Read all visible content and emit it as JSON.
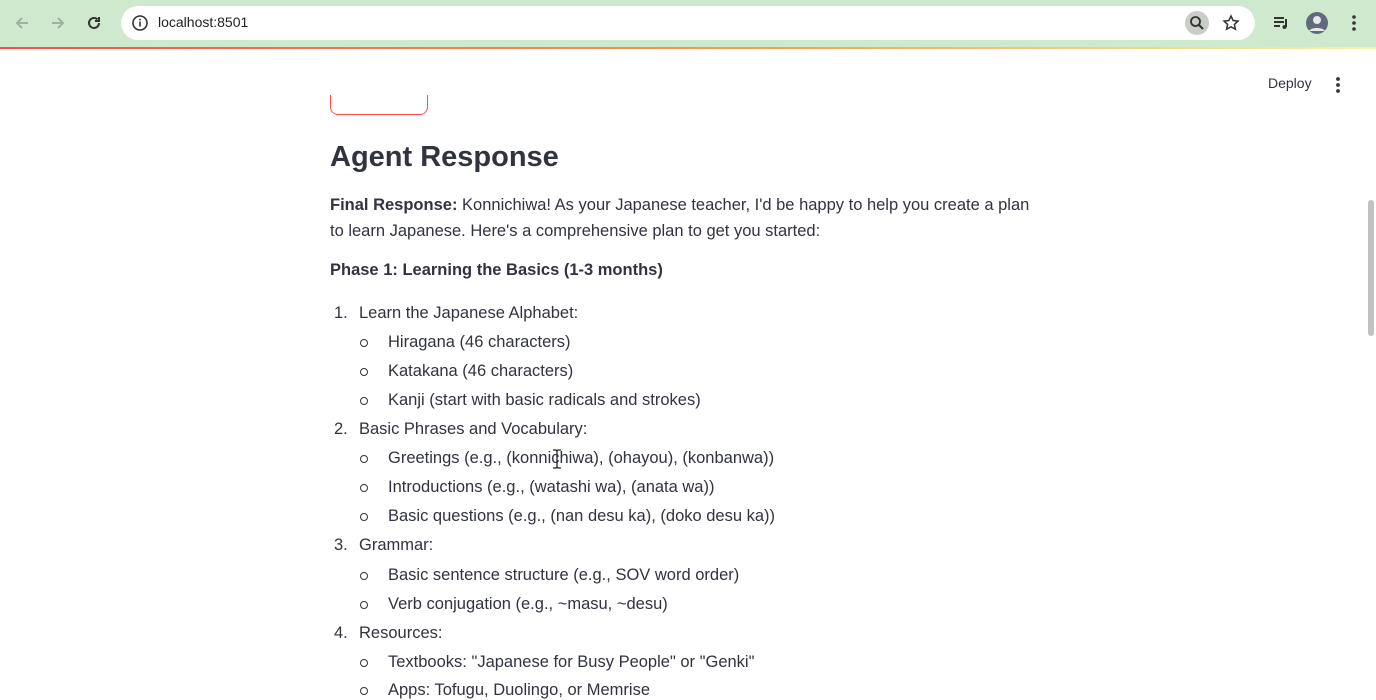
{
  "browser": {
    "url": "localhost:8501",
    "icons": {
      "back": "back-arrow-icon",
      "forward": "forward-arrow-icon",
      "reload": "reload-icon",
      "site_info": "info-icon",
      "zoom": "zoom-icon",
      "bookmark": "star-icon",
      "media": "media-control-icon",
      "profile": "profile-avatar-icon",
      "menu": "more-vertical-icon"
    }
  },
  "app_header": {
    "deploy_label": "Deploy",
    "menu_icon": "more-vertical-icon"
  },
  "main": {
    "section_title": "Agent Response",
    "final_response_label": "Final Response:",
    "final_response_text": " Konnichiwa! As your Japanese teacher, I'd be happy to help you create a plan to learn Japanese. Here's a comprehensive plan to get you started:",
    "phase_heading": "Phase 1: Learning the Basics (1-3 months)",
    "items": [
      {
        "number": "1.",
        "label": "Learn the Japanese Alphabet:",
        "subitems": [
          "Hiragana (46 characters)",
          "Katakana (46 characters)",
          "Kanji (start with basic radicals and strokes)"
        ]
      },
      {
        "number": "2.",
        "label": "Basic Phrases and Vocabulary:",
        "subitems": [
          "Greetings (e.g., (konnichiwa), (ohayou), (konbanwa))",
          "Introductions (e.g., (watashi wa), (anata wa))",
          "Basic questions (e.g., (nan desu ka), (doko desu ka))"
        ]
      },
      {
        "number": "3.",
        "label": "Grammar:",
        "subitems": [
          "Basic sentence structure (e.g., SOV word order)",
          "Verb conjugation (e.g., ~masu, ~desu)"
        ]
      },
      {
        "number": "4.",
        "label": "Resources:",
        "subitems": [
          "Textbooks: \"Japanese for Busy People\" or \"Genki\"",
          "Apps: Tofugu, Duolingo, or Memrise"
        ]
      }
    ]
  },
  "colors": {
    "browser_bar": "#cfe9cf",
    "accent": "#ff4b4b",
    "text": "#31333f"
  }
}
